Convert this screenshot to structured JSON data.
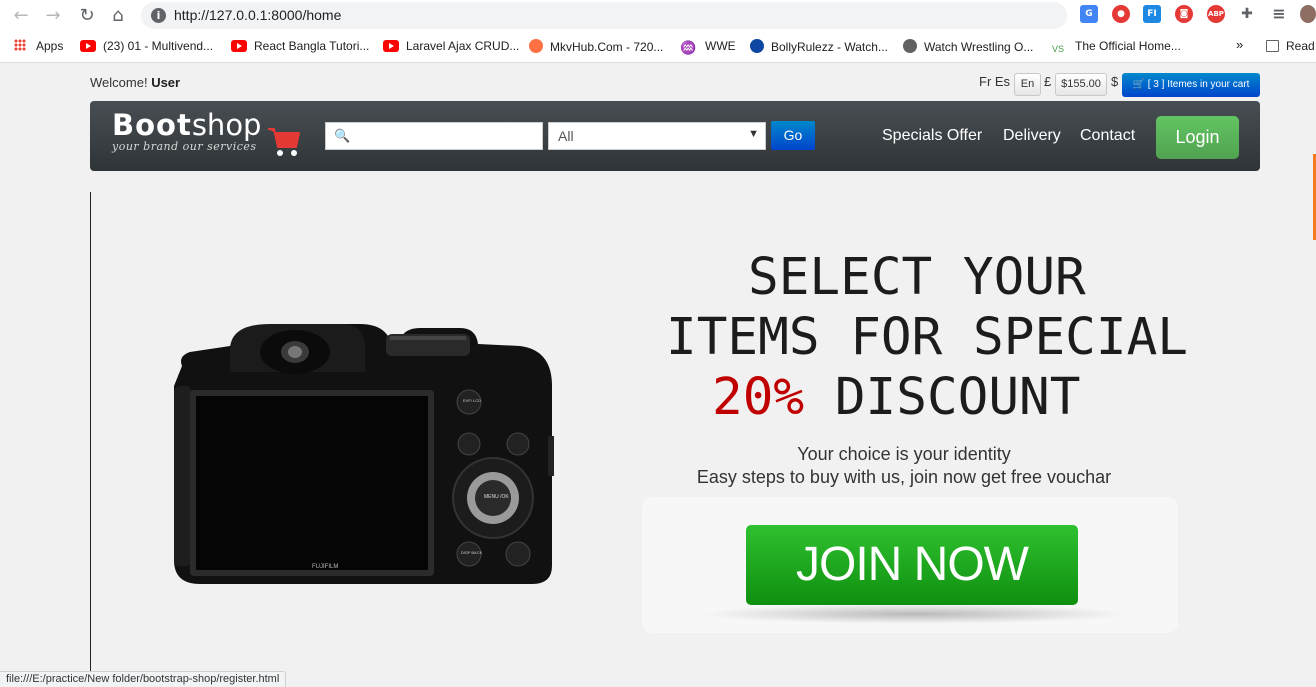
{
  "browser": {
    "url": "http://127.0.0.1:8000/home",
    "nav": {
      "back": "←",
      "forward": "→",
      "reload": "↻",
      "home": "⌂"
    },
    "extensions": [
      {
        "name": "google-translate-icon",
        "label": "G",
        "color": "#4285f4"
      },
      {
        "name": "record-icon",
        "label": "●",
        "color": "#e53935"
      },
      {
        "name": "fi-extension-icon",
        "label": "FI",
        "color": "#1e88e5"
      },
      {
        "name": "screenshot-icon",
        "label": "◙",
        "color": "#e53935"
      },
      {
        "name": "adblock-plus-icon",
        "label": "ABP",
        "color": "#e53935"
      },
      {
        "name": "extensions-puzzle-icon",
        "label": "✚",
        "color": "#5f6368"
      },
      {
        "name": "media-queue-icon",
        "label": "≡",
        "color": "#5f6368"
      }
    ],
    "bookmarks": [
      {
        "label": "Apps",
        "icon": "apps-grid-icon"
      },
      {
        "label": "(23) 01 - Multivend...",
        "icon": "youtube-icon"
      },
      {
        "label": "React Bangla Tutori...",
        "icon": "youtube-icon"
      },
      {
        "label": "Laravel Ajax CRUD...",
        "icon": "youtube-icon"
      },
      {
        "label": "MkvHub.Com - 720...",
        "icon": "mkvhub-icon"
      },
      {
        "label": "WWE",
        "icon": "wwe-icon"
      },
      {
        "label": "BollyRulezz - Watch...",
        "icon": "bollyrulezz-icon"
      },
      {
        "label": "Watch Wrestling O...",
        "icon": "wordpress-icon"
      },
      {
        "label": "The Official Home...",
        "icon": "official-home-icon"
      }
    ],
    "bookmarks_overflow": "»",
    "reading_list": "Read",
    "status_url": "file:///E:/practice/New folder/bootstrap-shop/register.html"
  },
  "topbar": {
    "welcome": "Welcome!",
    "user": "User",
    "currency_text": "Fr Es",
    "lang": "En",
    "pound": "£",
    "amount": "$155.00",
    "dollar": "$",
    "cart": "[ 3 ] Itemes in your cart"
  },
  "navbar": {
    "logo_bold": "Boot",
    "logo_light": "shop",
    "tagline": "your brand our services",
    "search_value": "",
    "category": "All",
    "go": "Go",
    "links": [
      "Specials Offer",
      "Delivery",
      "Contact"
    ],
    "login": "Login"
  },
  "hero": {
    "line1": "SELECT YOUR",
    "line2": "ITEMS FOR SPECIAL",
    "line3_accent": "20%",
    "line3_rest": " DISCOUNT",
    "sub1": "Your choice is your identity",
    "sub2": "Easy steps to buy with us, join now get free vouchar",
    "join": "JOIN NOW",
    "camera_brand": "FUJIFILM",
    "camera_btn_evf": "EVF/ LCD",
    "camera_btn_menu": "MENU /OK",
    "camera_btn_disp": "DISP BACK",
    "accent_color": "#c00000"
  }
}
